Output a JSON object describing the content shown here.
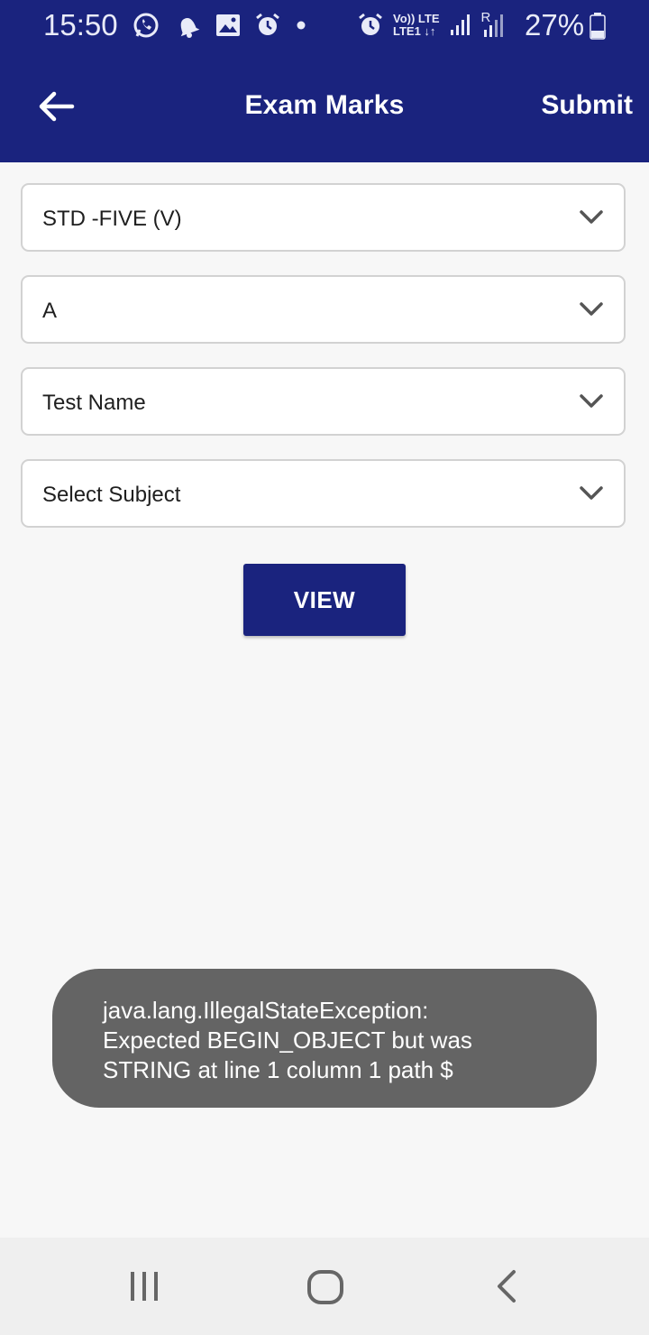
{
  "status_bar": {
    "time": "15:50",
    "battery_percent": "27%",
    "network_top": "Vo)) LTE",
    "network_bottom": "LTE1 ↓↑",
    "roaming": "R",
    "icons": [
      "whatsapp-icon",
      "notification-bell-icon",
      "gallery-icon",
      "alarm-icon",
      "dot-icon",
      "alarm-icon",
      "volte-icon",
      "signal-icon",
      "signal-roaming-icon",
      "battery-icon"
    ]
  },
  "app_bar": {
    "title": "Exam Marks",
    "submit_label": "Submit",
    "back_icon": "arrow-left-icon"
  },
  "form": {
    "class_select": "STD -FIVE (V)",
    "section_select": "A",
    "test_select": "Test Name",
    "subject_select": "Select Subject",
    "view_button": "VIEW"
  },
  "toast": {
    "line1": "java.lang.IllegalStateException:",
    "line2": "Expected BEGIN_OBJECT but was",
    "line3": "STRING at line 1 column 1 path $"
  },
  "nav_bar": {
    "items": [
      "recent-apps-icon",
      "home-icon",
      "back-icon"
    ]
  },
  "colors": {
    "primary": "#1a237e",
    "toast_bg": "#646464",
    "background": "#f7f7f7"
  }
}
